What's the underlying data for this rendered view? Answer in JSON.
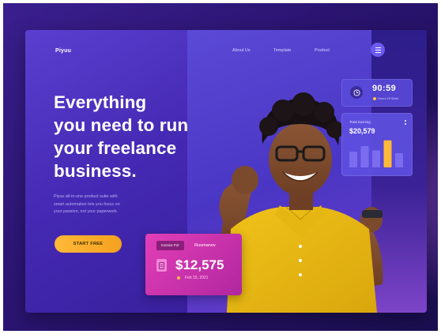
{
  "brand": {
    "name": "Piyuu"
  },
  "nav": {
    "items": [
      {
        "label": "About Us"
      },
      {
        "label": "Template"
      },
      {
        "label": "Product"
      }
    ]
  },
  "hero": {
    "lines": [
      "Everything",
      "you need to run",
      "your freelance",
      "business."
    ],
    "description": [
      "Piyuu all-in-one product suite with",
      "smart automation lets you focus on",
      "your passion, not your paperwork."
    ],
    "cta_label": "START FREE"
  },
  "time_card": {
    "value": "90:59",
    "label": "Hours Of Work"
  },
  "earning_card": {
    "label": "Total Earning",
    "value": "$20,579",
    "bars": [
      {
        "level": 0.55,
        "highlight": false
      },
      {
        "level": 0.75,
        "highlight": false
      },
      {
        "level": 0.6,
        "highlight": false
      },
      {
        "level": 0.95,
        "highlight": true
      },
      {
        "level": 0.5,
        "highlight": false
      }
    ]
  },
  "invoice_card": {
    "badge": "Invoice For",
    "name": "Rusmanov",
    "amount": "$12,575",
    "date": "Feb 15, 2021"
  },
  "colors": {
    "accent": "#ffb938",
    "invoice": "#e23fb7",
    "panel": "#5b4ad6",
    "background": "#2a1470"
  }
}
